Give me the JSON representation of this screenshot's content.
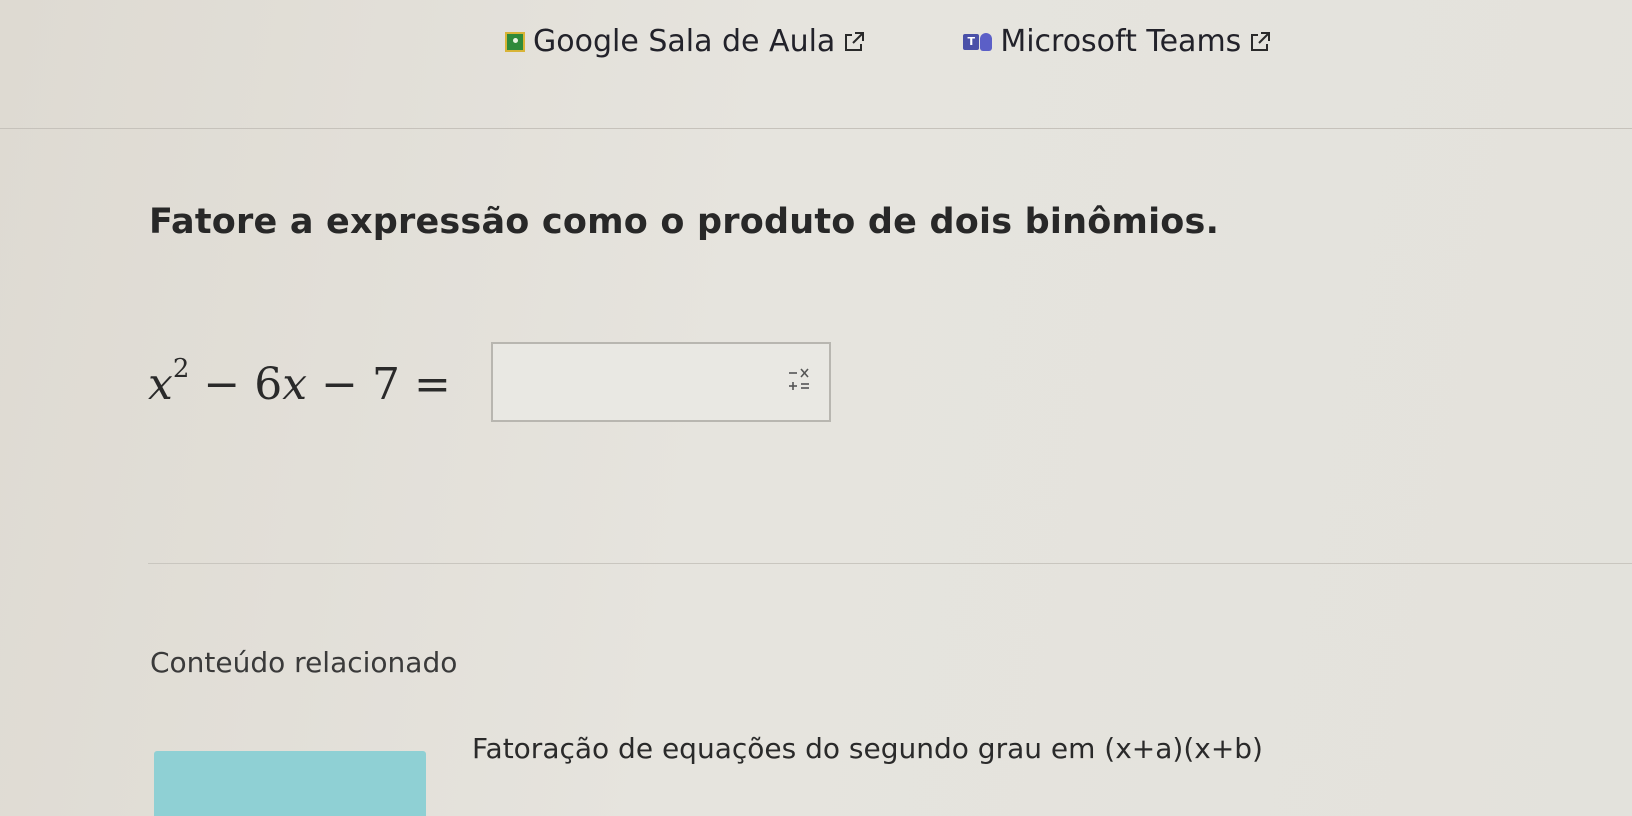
{
  "share": {
    "classroom_label": "Google Sala de Aula",
    "teams_label": "Microsoft Teams",
    "teams_icon_letter": "T"
  },
  "question": {
    "prompt": "Fatore a expressão como o produto de dois binômios.",
    "equation": {
      "term1_var": "x",
      "term1_exp": "2",
      "op1": "−",
      "term2": "6",
      "term2_var": "x",
      "op2": "−",
      "term3": "7",
      "equals": "="
    },
    "answer_value": ""
  },
  "related": {
    "heading": "Conteúdo relacionado",
    "item_title": "Fatoração de equações do segundo grau em (x+a)(x+b)"
  },
  "colors": {
    "thumbnail": "#8fd0d4",
    "classroom_green": "#2f8a3a",
    "teams_purple": "#4a50a8"
  }
}
